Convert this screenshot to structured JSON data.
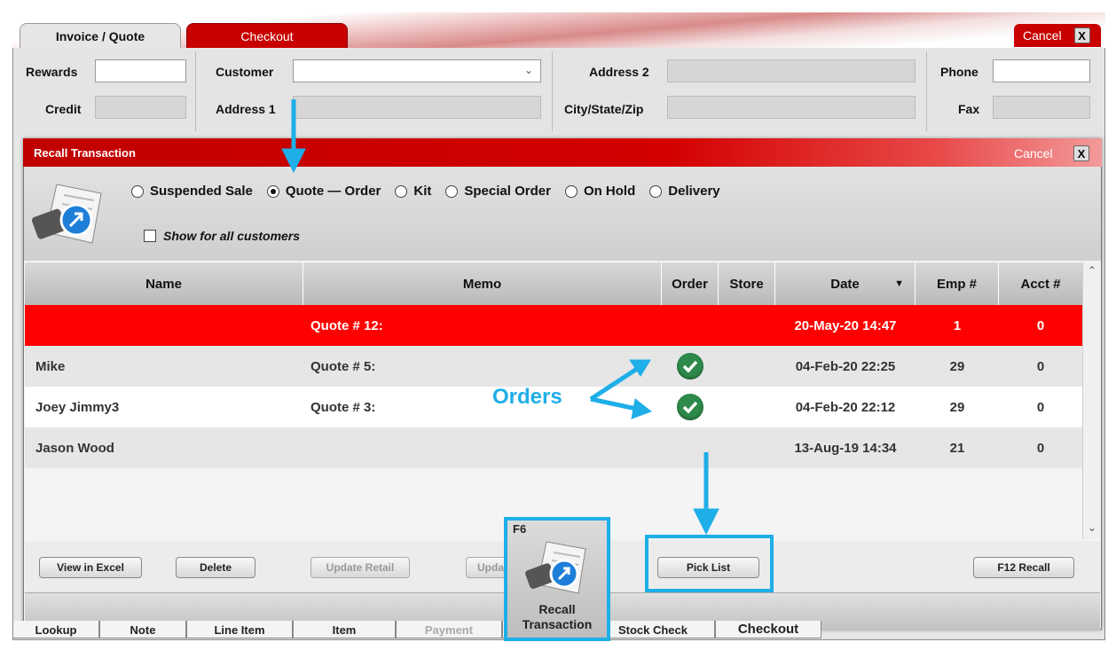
{
  "tabs": {
    "invoice": "Invoice / Quote",
    "checkout": "Checkout",
    "cancel": "Cancel",
    "close": "X"
  },
  "form": {
    "rewards": "Rewards",
    "credit": "Credit",
    "customer": "Customer",
    "address1": "Address 1",
    "address2": "Address 2",
    "city": "City/State/Zip",
    "phone": "Phone",
    "fax": "Fax"
  },
  "dialog": {
    "title": "Recall Transaction",
    "cancel": "Cancel",
    "close": "X",
    "radios": [
      "Suspended Sale",
      "Quote — Order",
      "Kit",
      "Special Order",
      "On Hold",
      "Delivery"
    ],
    "selected_radio": "Quote — Order",
    "show_all": "Show for all customers"
  },
  "grid": {
    "headers": {
      "name": "Name",
      "memo": "Memo",
      "order": "Order",
      "store": "Store",
      "date": "Date",
      "emp": "Emp #",
      "acct": "Acct #"
    },
    "rows": [
      {
        "name": "",
        "memo": "Quote # 12:",
        "order": false,
        "date": "20-May-20 14:47",
        "emp": "1",
        "acct": "0",
        "selected": true
      },
      {
        "name": "Mike",
        "memo": "Quote # 5:",
        "order": true,
        "date": "04-Feb-20 22:25",
        "emp": "29",
        "acct": "0"
      },
      {
        "name": "Joey Jimmy3",
        "memo": "Quote # 3:",
        "order": true,
        "date": "04-Feb-20 22:12",
        "emp": "29",
        "acct": "0"
      },
      {
        "name": "Jason Wood",
        "memo": "",
        "order": false,
        "date": "13-Aug-19 14:34",
        "emp": "21",
        "acct": "0"
      }
    ]
  },
  "buttons": {
    "view_excel": "View in Excel",
    "delete": "Delete",
    "update_retail": "Update Retail",
    "update2": "Upda",
    "pick_list": "Pick List",
    "recall": "F12  Recall"
  },
  "callout": {
    "fkey": "F6",
    "label_line1": "Recall",
    "label_line2": "Transaction",
    "orders": "Orders"
  },
  "bottom_tabs": [
    "Lookup",
    "Note",
    "Line Item",
    "Item",
    "Payment",
    "Stock Check",
    "Checkout"
  ],
  "colors": {
    "accent_red": "#c80000",
    "selected_row": "#ff0000",
    "callout_blue": "#1eaee8",
    "check_green": "#2d8a4a"
  }
}
